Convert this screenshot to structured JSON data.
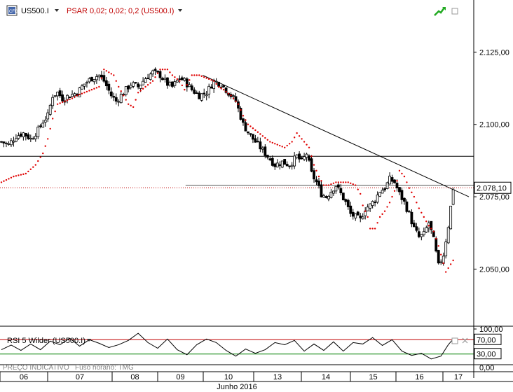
{
  "instrument_label": "US500.I",
  "indicator_label": "PSAR 0,02; 0,02; 0,2 (US500.I)",
  "rsi_label": "RSI 5 Wilder (US500.I)",
  "footer_label": "PREÇO INDICATIVO",
  "timezone_label": "Fuso horário: TMG",
  "month_label": "Junho 2016",
  "colors": {
    "candle": "#000000",
    "psar": "#e00000",
    "price_line": "#c00000",
    "rsi_upper": "#c00000",
    "rsi_lower": "#008000",
    "rsi_line": "#000000"
  },
  "icons": [
    "chart-icon",
    "dropdown-arrow-icon",
    "trend-up-icon",
    "window-square-icon"
  ],
  "chart_data": [
    {
      "type": "candlestick",
      "y_ticks": [
        "2.050,00",
        "2.075,00",
        "2.100,00",
        "2.125,00"
      ],
      "ylim": [
        2030.5,
        2143.0
      ],
      "x_ticks": [
        "06",
        "07",
        "08",
        "09",
        "10",
        "13",
        "14",
        "15",
        "16",
        "17"
      ],
      "current_price": "2.078,10",
      "close_path": [
        [
          0,
          2094
        ],
        [
          3,
          2093
        ],
        [
          6,
          2096
        ],
        [
          9,
          2097
        ],
        [
          12,
          2095
        ],
        [
          15,
          2098
        ],
        [
          17,
          2101
        ],
        [
          19,
          2103
        ],
        [
          21,
          2110
        ],
        [
          23,
          2111
        ],
        [
          25,
          2109
        ],
        [
          28,
          2110
        ],
        [
          31,
          2111
        ],
        [
          34,
          2114
        ],
        [
          37,
          2116
        ],
        [
          40,
          2117
        ],
        [
          42,
          2115
        ],
        [
          45,
          2110
        ],
        [
          47,
          2108
        ],
        [
          50,
          2111
        ],
        [
          53,
          2114
        ],
        [
          56,
          2113
        ],
        [
          59,
          2116
        ],
        [
          62,
          2118
        ],
        [
          65,
          2117
        ],
        [
          68,
          2114
        ],
        [
          70,
          2113
        ],
        [
          73,
          2116
        ],
        [
          75,
          2115
        ],
        [
          78,
          2112
        ],
        [
          81,
          2110
        ],
        [
          84,
          2111
        ],
        [
          87,
          2115
        ],
        [
          90,
          2114
        ],
        [
          93,
          2111
        ],
        [
          96,
          2108
        ],
        [
          99,
          2100
        ],
        [
          102,
          2096
        ],
        [
          105,
          2093
        ],
        [
          108,
          2090
        ],
        [
          110,
          2088
        ],
        [
          112,
          2086
        ],
        [
          115,
          2087
        ],
        [
          118,
          2086
        ],
        [
          121,
          2089
        ],
        [
          123,
          2087
        ],
        [
          125,
          2090
        ],
        [
          127,
          2083
        ],
        [
          129,
          2080
        ],
        [
          131,
          2076
        ],
        [
          133,
          2075
        ],
        [
          135,
          2077
        ],
        [
          137,
          2079
        ],
        [
          139,
          2076
        ],
        [
          141,
          2073
        ],
        [
          143,
          2069
        ],
        [
          145,
          2068
        ],
        [
          147,
          2067
        ],
        [
          149,
          2071
        ],
        [
          151,
          2072
        ],
        [
          153,
          2074
        ],
        [
          155,
          2077
        ],
        [
          157,
          2078
        ],
        [
          159,
          2081
        ],
        [
          161,
          2080
        ],
        [
          163,
          2076
        ],
        [
          165,
          2073
        ],
        [
          167,
          2069
        ],
        [
          169,
          2064
        ],
        [
          171,
          2061
        ],
        [
          173,
          2062
        ],
        [
          175,
          2066
        ],
        [
          177,
          2060
        ],
        [
          179,
          2051
        ],
        [
          181,
          2055
        ],
        [
          183,
          2065
        ],
        [
          185,
          2078
        ]
      ],
      "psar_dots": [
        [
          0,
          2080
        ],
        [
          5,
          2082
        ],
        [
          10,
          2083
        ],
        [
          14,
          2086
        ],
        [
          17,
          2090
        ],
        [
          19,
          2095
        ],
        [
          21,
          2102
        ],
        [
          23,
          2107
        ],
        [
          26,
          2108
        ],
        [
          29,
          2109
        ],
        [
          31,
          2110
        ],
        [
          34,
          2111
        ],
        [
          37,
          2112
        ],
        [
          40,
          2113
        ],
        [
          42,
          2119
        ],
        [
          44,
          2118
        ],
        [
          46,
          2117
        ],
        [
          48,
          2113
        ],
        [
          50,
          2110
        ],
        [
          52,
          2107
        ],
        [
          54,
          2106
        ],
        [
          56,
          2111
        ],
        [
          59,
          2113
        ],
        [
          62,
          2115
        ],
        [
          65,
          2119
        ],
        [
          68,
          2119
        ],
        [
          70,
          2117
        ],
        [
          73,
          2115
        ],
        [
          75,
          2112
        ],
        [
          78,
          2117
        ],
        [
          81,
          2117
        ],
        [
          84,
          2116
        ],
        [
          87,
          2115
        ],
        [
          89,
          2113
        ],
        [
          91,
          2112
        ],
        [
          94,
          2110
        ],
        [
          97,
          2107
        ],
        [
          99,
          2103
        ],
        [
          101,
          2100
        ],
        [
          104,
          2098
        ],
        [
          107,
          2096
        ],
        [
          110,
          2094
        ],
        [
          113,
          2093
        ],
        [
          116,
          2092
        ],
        [
          119,
          2094
        ],
        [
          121,
          2097
        ],
        [
          123,
          2095
        ],
        [
          126,
          2092
        ],
        [
          128,
          2086
        ],
        [
          130,
          2082
        ],
        [
          132,
          2079
        ],
        [
          134,
          2079
        ],
        [
          137,
          2080
        ],
        [
          140,
          2080
        ],
        [
          142,
          2080
        ],
        [
          145,
          2079
        ],
        [
          147,
          2076
        ],
        [
          148,
          2072
        ],
        [
          150,
          2068
        ],
        [
          151,
          2064
        ],
        [
          153,
          2064
        ],
        [
          155,
          2068
        ],
        [
          157,
          2070
        ],
        [
          159,
          2073
        ],
        [
          161,
          2077
        ],
        [
          163,
          2084
        ],
        [
          165,
          2082
        ],
        [
          167,
          2078
        ],
        [
          169,
          2075
        ],
        [
          171,
          2071
        ],
        [
          173,
          2068
        ],
        [
          175,
          2065
        ],
        [
          177,
          2063
        ],
        [
          179,
          2058
        ],
        [
          182,
          2049
        ],
        [
          185,
          2053
        ]
      ],
      "horizontal_line": 2089,
      "support_line": 2079,
      "trendline": [
        [
          83,
          2117
        ],
        [
          192,
          2075
        ]
      ],
      "last_x": 185
    },
    {
      "type": "line",
      "name": "RSI",
      "y_ticks": [
        "100,00",
        "70,00",
        "30,00",
        "0,00"
      ],
      "ylim": [
        0,
        100
      ],
      "overbought": 70,
      "oversold": 30,
      "overbought_label": "70,00",
      "oversold_label": "30,00",
      "points": [
        [
          0,
          42
        ],
        [
          4,
          55
        ],
        [
          8,
          40
        ],
        [
          12,
          58
        ],
        [
          16,
          42
        ],
        [
          20,
          66
        ],
        [
          24,
          56
        ],
        [
          28,
          74
        ],
        [
          32,
          52
        ],
        [
          36,
          70
        ],
        [
          40,
          60
        ],
        [
          44,
          48
        ],
        [
          48,
          56
        ],
        [
          52,
          68
        ],
        [
          56,
          88
        ],
        [
          60,
          62
        ],
        [
          64,
          46
        ],
        [
          68,
          72
        ],
        [
          72,
          42
        ],
        [
          76,
          28
        ],
        [
          80,
          56
        ],
        [
          84,
          72
        ],
        [
          88,
          62
        ],
        [
          92,
          40
        ],
        [
          96,
          24
        ],
        [
          100,
          44
        ],
        [
          104,
          32
        ],
        [
          108,
          42
        ],
        [
          112,
          62
        ],
        [
          116,
          56
        ],
        [
          120,
          68
        ],
        [
          124,
          38
        ],
        [
          128,
          58
        ],
        [
          132,
          40
        ],
        [
          136,
          64
        ],
        [
          140,
          38
        ],
        [
          144,
          62
        ],
        [
          148,
          58
        ],
        [
          152,
          76
        ],
        [
          156,
          54
        ],
        [
          160,
          70
        ],
        [
          164,
          38
        ],
        [
          168,
          26
        ],
        [
          172,
          32
        ],
        [
          176,
          16
        ],
        [
          180,
          24
        ],
        [
          183,
          56
        ],
        [
          185,
          72
        ]
      ]
    }
  ]
}
